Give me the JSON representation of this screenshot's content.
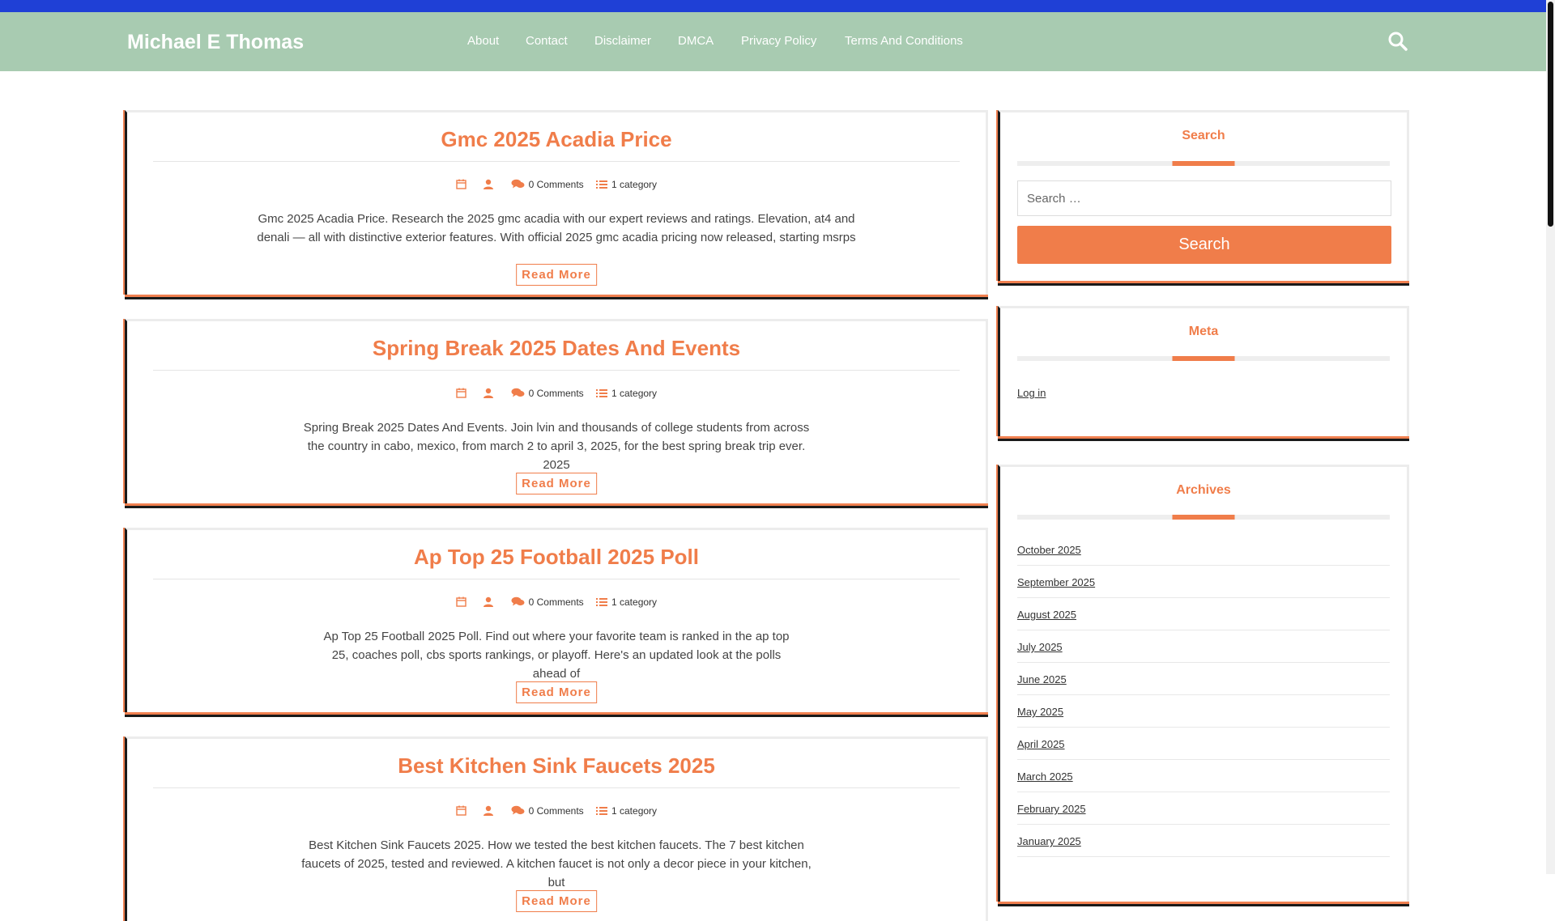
{
  "header": {
    "site_title": "Michael E Thomas",
    "nav": [
      "About",
      "Contact",
      "Disclaimer",
      "DMCA",
      "Privacy Policy",
      "Terms And Conditions"
    ],
    "search_icon": "search-icon"
  },
  "posts": [
    {
      "title": "Gmc 2025 Acadia Price",
      "comments": "0 Comments",
      "category": "1 category",
      "excerpt": "Gmc 2025 Acadia Price. Research the 2025 gmc acadia with our expert reviews and ratings. Elevation, at4 and denali — all with distinctive exterior features. With official 2025 gmc acadia pricing now released, starting msrps",
      "read_more": "Read More"
    },
    {
      "title": "Spring Break 2025 Dates And Events",
      "comments": "0 Comments",
      "category": "1 category",
      "excerpt": "Spring Break 2025 Dates And Events. Join lvin and thousands of college students from across the country in cabo, mexico, from march 2 to april 3, 2025, for the best spring break trip ever. 2025",
      "read_more": "Read More"
    },
    {
      "title": "Ap Top 25 Football 2025 Poll",
      "comments": "0 Comments",
      "category": "1 category",
      "excerpt": "Ap Top 25 Football 2025 Poll. Find out where your favorite team is ranked in the ap top 25, coaches poll, cbs sports rankings, or playoff. Here's an updated look at the polls ahead of",
      "read_more": "Read More"
    },
    {
      "title": "Best Kitchen Sink Faucets 2025",
      "comments": "0 Comments",
      "category": "1 category",
      "excerpt": "Best Kitchen Sink Faucets 2025. How we tested the best kitchen faucets. The 7 best kitchen faucets of 2025, tested and reviewed. A kitchen faucet is not only a decor piece in your kitchen, but",
      "read_more": "Read More"
    }
  ],
  "sidebar": {
    "search": {
      "title": "Search",
      "placeholder": "Search …",
      "button": "Search"
    },
    "meta": {
      "title": "Meta",
      "links": [
        "Log in"
      ]
    },
    "archives": {
      "title": "Archives",
      "items": [
        "October 2025",
        "September 2025",
        "August 2025",
        "July 2025",
        "June 2025",
        "May 2025",
        "April 2025",
        "March 2025",
        "February 2025",
        "January 2025"
      ]
    }
  },
  "colors": {
    "accent": "#f07d4a",
    "header_bg": "#a8cbb1",
    "top_strip": "#1f40d6"
  },
  "icons": {
    "date": "calendar-icon",
    "author": "user-icon",
    "comments": "comments-icon",
    "category": "list-icon"
  }
}
